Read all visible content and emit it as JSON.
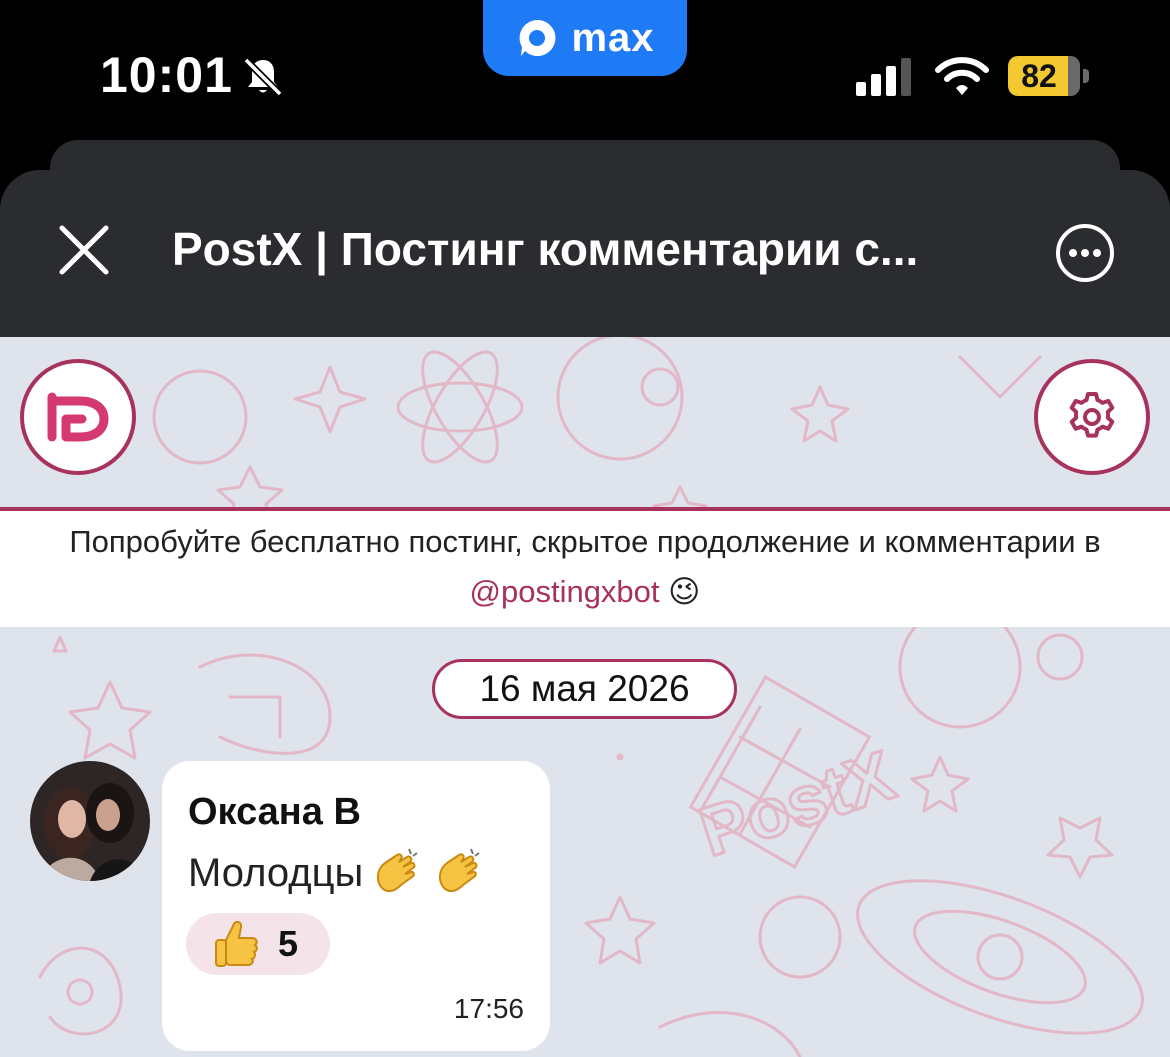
{
  "status_bar": {
    "time": "10:01",
    "battery_level": "82",
    "pill_label": "max",
    "icons": [
      "bell-slash-icon",
      "signal-icon",
      "wifi-icon",
      "battery-icon"
    ]
  },
  "header": {
    "title": "PostX | Постинг комментарии с...",
    "close_icon": "close-icon",
    "more_icon": "more-icon"
  },
  "toolbar": {
    "logo_icon": "postx-logo-icon",
    "settings_icon": "gear-icon"
  },
  "promo": {
    "text": "Попробуйте бесплатно постинг, скрытое продолжение и комментарии в ",
    "link": "@postingxbot",
    "emoji": "😉"
  },
  "date_chip": "16 мая 2026",
  "message": {
    "author": "Оксана В",
    "text": "Молодцы",
    "emoji_icon": "clapping-hands-icon",
    "reaction_icon": "thumbs-up-icon",
    "reaction_count": "5",
    "time": "17:56"
  },
  "colors": {
    "accent": "#a8325e",
    "pill": "#1f7af5",
    "header_bg": "#2b2c2f",
    "chat_bg": "#dfe3ec",
    "battery": "#f4c830"
  }
}
